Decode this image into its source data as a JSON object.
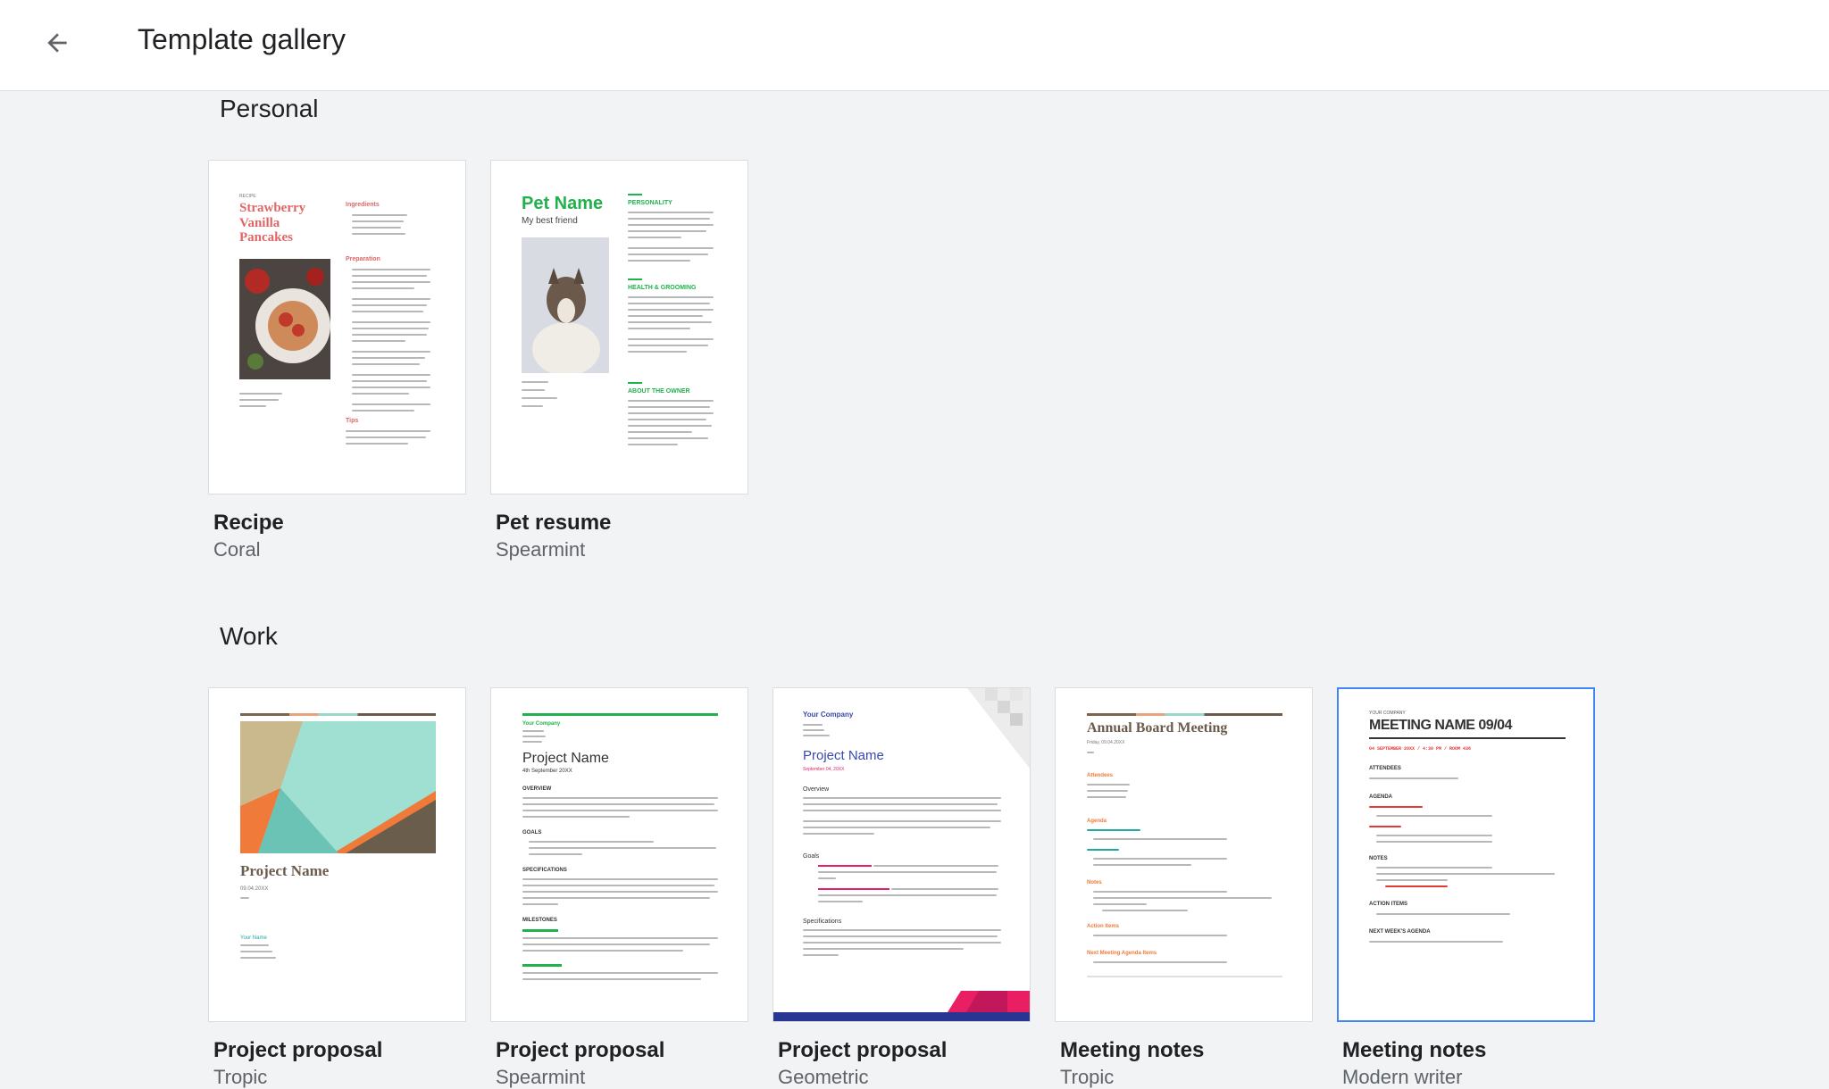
{
  "header": {
    "title": "Template gallery",
    "back_icon": "arrow-back-icon"
  },
  "sections": [
    {
      "title": "Personal",
      "templates": [
        {
          "title": "Recipe",
          "subtitle": "Coral",
          "preview": {
            "kicker": "RECIPE",
            "heading": "Strawberry Vanilla Pancakes",
            "h1": "Ingredients",
            "h2": "Preparation",
            "h3": "Tips",
            "accent": "#e06666"
          }
        },
        {
          "title": "Pet resume",
          "subtitle": "Spearmint",
          "preview": {
            "heading": "Pet Name",
            "tagline": "My best friend",
            "h1": "PERSONALITY",
            "h2": "HEALTH & GROOMING",
            "h3": "ABOUT THE OWNER",
            "accent": "#21b24d"
          }
        }
      ]
    },
    {
      "title": "Work",
      "templates": [
        {
          "title": "Project proposal",
          "subtitle": "Tropic",
          "preview": {
            "heading": "Project Name",
            "date": "09.04.20XX",
            "label": "Your Name"
          }
        },
        {
          "title": "Project proposal",
          "subtitle": "Spearmint",
          "preview": {
            "company": "Your Company",
            "heading": "Project Name",
            "date": "4th September 20XX",
            "h1": "OVERVIEW",
            "h2": "GOALS",
            "h3": "SPECIFICATIONS",
            "h4": "MILESTONES"
          }
        },
        {
          "title": "Project proposal",
          "subtitle": "Geometric",
          "preview": {
            "company": "Your Company",
            "heading": "Project Name",
            "date": "September 04, 20XX",
            "h1": "Overview",
            "h2": "Goals",
            "h3": "Specifications"
          }
        },
        {
          "title": "Meeting notes",
          "subtitle": "Tropic",
          "preview": {
            "heading": "Annual Board Meeting",
            "date": "Friday, 09.04.20XX",
            "h1": "Attendees",
            "h2": "Agenda",
            "h3": "Notes",
            "h4": "Action Items",
            "h5": "Next Meeting Agenda Items"
          }
        },
        {
          "title": "Meeting notes",
          "subtitle": "Modern writer",
          "preview": {
            "company": "YOUR COMPANY",
            "heading": "MEETING NAME 09/04",
            "date": "04 SEPTEMBER 20XX / 4:30 PM / ROOM 436",
            "h1": "ATTENDEES",
            "h2": "AGENDA",
            "h3": "NOTES",
            "h4": "ACTION ITEMS",
            "h5": "NEXT WEEK'S AGENDA"
          }
        }
      ]
    }
  ],
  "colors": {
    "accent_selected": "#4285f4",
    "background": "#f1f3f4"
  }
}
